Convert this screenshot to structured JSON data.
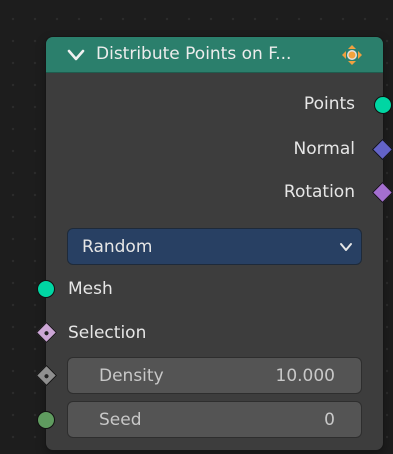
{
  "node": {
    "title": "Distribute Points on F...",
    "header_color": "#2b7f6c",
    "collapse_icon": "chevron-down-icon",
    "header_icon": "node-gizmo-icon"
  },
  "outputs": [
    {
      "label": "Points",
      "socket": "geometry-socket",
      "color": "#00d6a3"
    },
    {
      "label": "Normal",
      "socket": "vector-socket",
      "color": "#6363c7"
    },
    {
      "label": "Rotation",
      "socket": "rotation-socket",
      "color": "#a46fd1"
    }
  ],
  "distribute_method": {
    "selected": "Random",
    "icon": "chevron-down-icon"
  },
  "inputs": {
    "mesh": {
      "label": "Mesh",
      "socket": "geometry-socket",
      "color": "#00d6a3"
    },
    "selection": {
      "label": "Selection",
      "socket": "boolean-socket",
      "color": "#cca6d6"
    },
    "density": {
      "label": "Density",
      "value": "10.000",
      "socket": "float-socket",
      "color": "#8f8f8f"
    },
    "seed": {
      "label": "Seed",
      "value": "0",
      "socket": "integer-socket",
      "color": "#5f9b5f"
    }
  }
}
